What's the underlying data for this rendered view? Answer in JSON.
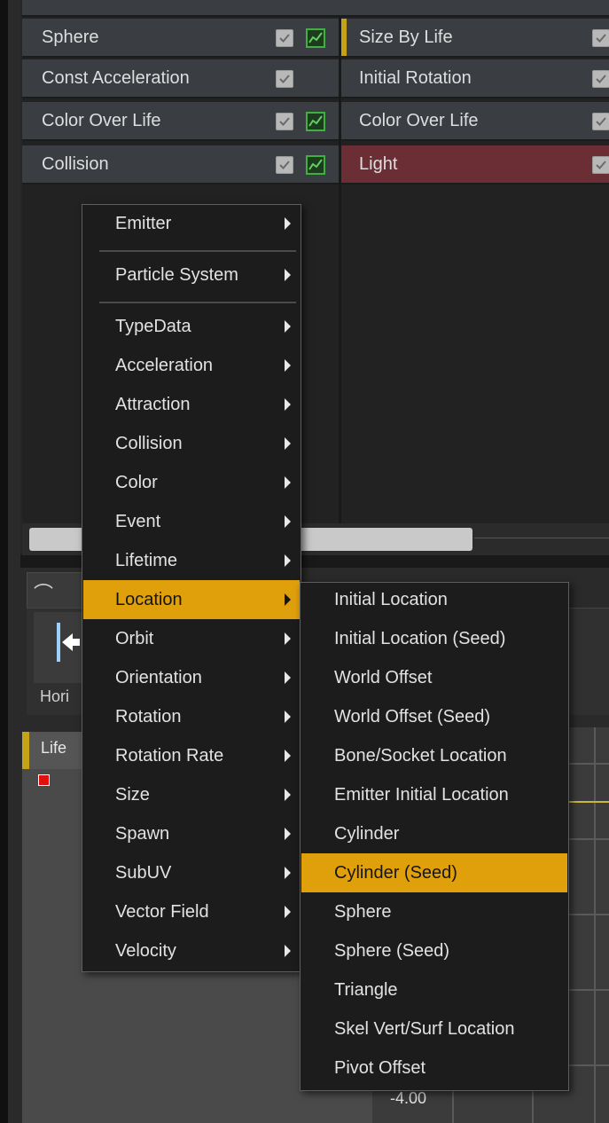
{
  "emitters": {
    "column1_modules": [
      {
        "label": "Sphere",
        "checked": true,
        "has_curve": true
      },
      {
        "label": "Const Acceleration",
        "checked": true,
        "has_curve": false
      },
      {
        "label": "Color Over Life",
        "checked": true,
        "has_curve": true
      },
      {
        "label": "Collision",
        "checked": true,
        "has_curve": true
      }
    ],
    "column2_modules": [
      {
        "label": "Size By Life",
        "checked": true
      },
      {
        "label": "Initial Rotation",
        "checked": true
      },
      {
        "label": "Color Over Life",
        "checked": true
      },
      {
        "label": "Light",
        "checked": true
      }
    ]
  },
  "curve_editor": {
    "toolbar_button": "Hori",
    "curve_item": "Life",
    "axis_value": "-4.00"
  },
  "context_menu": {
    "items": [
      {
        "label": "Emitter",
        "has_submenu": true
      },
      {
        "label": "Particle System",
        "has_submenu": true
      },
      {
        "label": "TypeData",
        "has_submenu": true
      },
      {
        "label": "Acceleration",
        "has_submenu": true
      },
      {
        "label": "Attraction",
        "has_submenu": true
      },
      {
        "label": "Collision",
        "has_submenu": true
      },
      {
        "label": "Color",
        "has_submenu": true
      },
      {
        "label": "Event",
        "has_submenu": true
      },
      {
        "label": "Lifetime",
        "has_submenu": true
      },
      {
        "label": "Location",
        "has_submenu": true,
        "highlighted": true
      },
      {
        "label": "Orbit",
        "has_submenu": true
      },
      {
        "label": "Orientation",
        "has_submenu": true
      },
      {
        "label": "Rotation",
        "has_submenu": true
      },
      {
        "label": "Rotation Rate",
        "has_submenu": true
      },
      {
        "label": "Size",
        "has_submenu": true
      },
      {
        "label": "Spawn",
        "has_submenu": true
      },
      {
        "label": "SubUV",
        "has_submenu": true
      },
      {
        "label": "Vector Field",
        "has_submenu": true
      },
      {
        "label": "Velocity",
        "has_submenu": true
      }
    ],
    "location_submenu": [
      {
        "label": "Initial Location"
      },
      {
        "label": "Initial Location (Seed)"
      },
      {
        "label": "World Offset"
      },
      {
        "label": "World Offset (Seed)"
      },
      {
        "label": "Bone/Socket Location"
      },
      {
        "label": "Emitter Initial Location"
      },
      {
        "label": "Cylinder"
      },
      {
        "label": "Cylinder (Seed)",
        "highlighted": true
      },
      {
        "label": "Sphere"
      },
      {
        "label": "Sphere (Seed)"
      },
      {
        "label": "Triangle"
      },
      {
        "label": "Skel Vert/Surf Location"
      },
      {
        "label": "Pivot Offset"
      }
    ]
  },
  "colors": {
    "highlight": "#e0a00c",
    "light_module_bg": "#6b2e35",
    "curve_toggle_green": "#40b040"
  }
}
